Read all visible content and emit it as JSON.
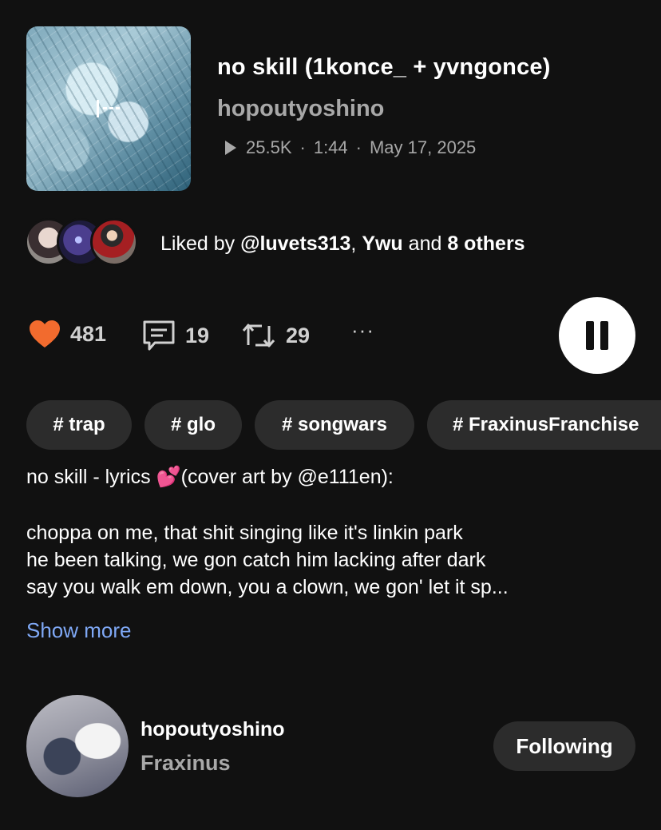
{
  "track": {
    "title": "no skill (1konce_ + yvngonce)",
    "artist": "hopoutyoshino",
    "plays": "25.5K",
    "duration": "1:44",
    "date": "May 17, 2025",
    "separator": "·",
    "cover_icon": "waveform-bars-icon"
  },
  "liked_by": {
    "prefix": "Liked by ",
    "user1": "@luvets313",
    "comma": ", ",
    "user2": "Ywu",
    "and": " and ",
    "others": "8 others"
  },
  "actions": {
    "likes": "481",
    "comments": "19",
    "reposts": "29",
    "more": "···",
    "like_color": "#f26b2e"
  },
  "tags": [
    "# trap",
    "# glo",
    "# songwars",
    "# FraxinusFranchise"
  ],
  "description": {
    "heading": "no skill - lyrics 💕(cover art by @e111en):",
    "lines": [
      "choppa on me, that shit singing like it's linkin park",
      "he been talking, we gon catch him lacking after dark",
      "say you walk em down, you a clown, we gon' let it sp..."
    ],
    "show_more": "Show more"
  },
  "user": {
    "name": "hopoutyoshino",
    "subtitle": "Fraxinus",
    "follow_label": "Following"
  },
  "colors": {
    "background": "#111111",
    "link": "#7fa8f5",
    "secondary_text": "#a8a8a8",
    "pill": "#2c2c2c"
  }
}
